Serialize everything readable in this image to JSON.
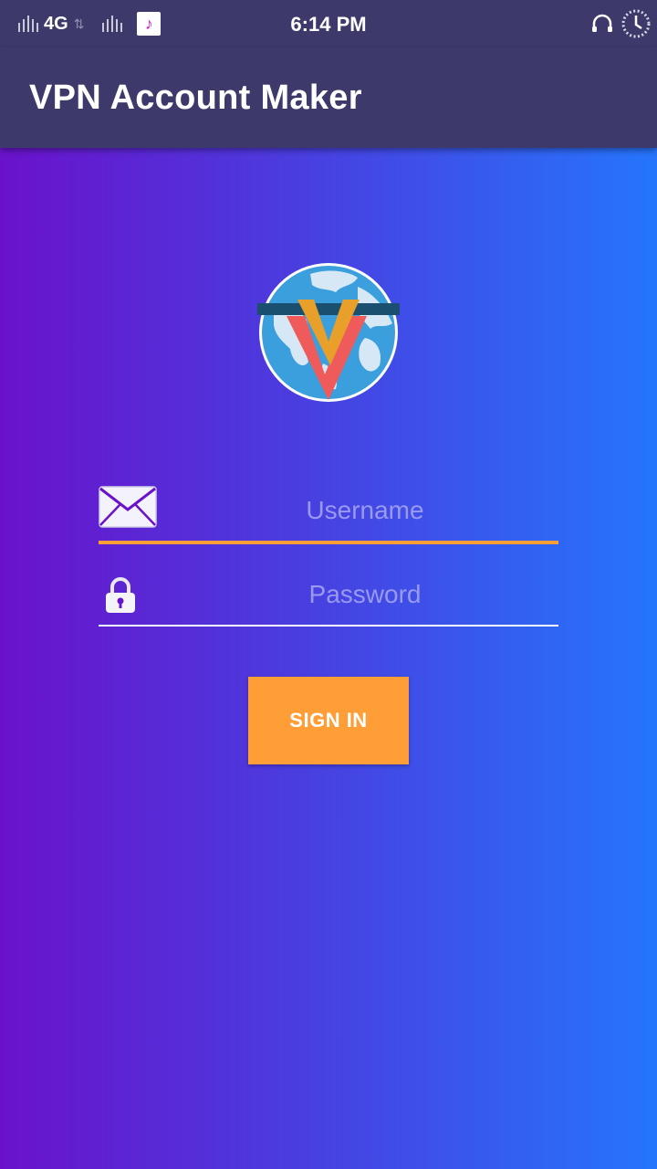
{
  "status_bar": {
    "network": "4G",
    "time": "6:14 PM"
  },
  "app_bar": {
    "title": "VPN Account Maker"
  },
  "logo": {
    "letter": "V",
    "icon": "globe-v-logo"
  },
  "form": {
    "username": {
      "placeholder": "Username",
      "value": "",
      "icon": "envelope-icon"
    },
    "password": {
      "placeholder": "Password",
      "value": "",
      "icon": "lock-icon"
    },
    "sign_in_label": "SIGN IN"
  },
  "colors": {
    "app_bar": "#3d3a6b",
    "gradient_start": "#6a12cb",
    "gradient_end": "#2575fc",
    "accent": "#ff9d37",
    "placeholder": "#9a99f0"
  }
}
